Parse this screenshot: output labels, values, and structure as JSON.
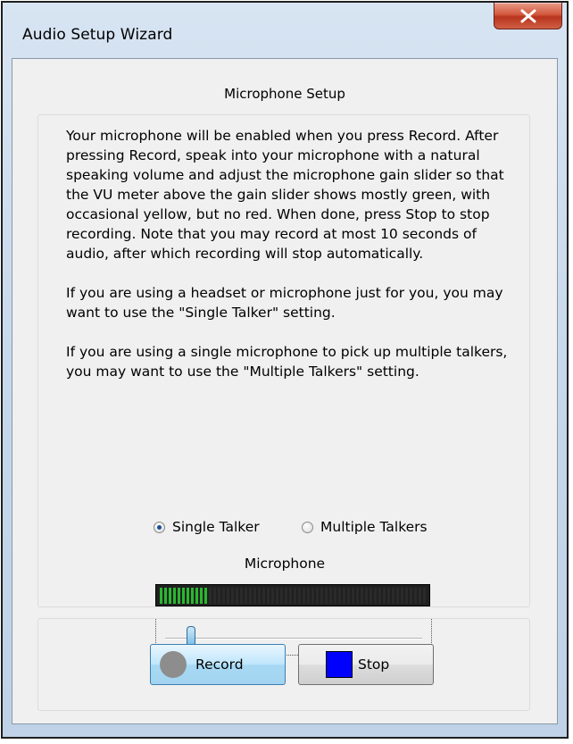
{
  "window": {
    "title": "Audio Setup Wizard"
  },
  "section": {
    "title": "Microphone Setup"
  },
  "instructions": {
    "p1": "Your microphone will be enabled when you press Record. After pressing Record, speak into your microphone with a natural speaking volume and adjust the microphone gain slider so that the VU meter above the gain slider shows mostly green, with occasional yellow, but no red.  When done, press Stop to stop recording.  Note that you may record at most 10 seconds of audio, after which recording will stop automatically.",
    "p2": "If you are using a headset or microphone just for you, you may want to use the \"Single Talker\" setting.",
    "p3": "If you are using a single microphone to pick up multiple talkers, you may want to use the \"Multiple Talkers\" setting."
  },
  "talker_mode": {
    "single_label": "Single Talker",
    "multiple_label": "Multiple Talkers",
    "selected": "single"
  },
  "microphone": {
    "label": "Microphone",
    "vu_level": 0.18,
    "gain_level": 0.1
  },
  "buttons": {
    "record_label": "Record",
    "stop_label": "Stop"
  },
  "colors": {
    "vu_active": "#29b82f",
    "stop_square": "#0000ff",
    "record_circle": "#8d8d8d",
    "close_button": "#c7452a"
  },
  "icons": {
    "close": "close-x-icon",
    "record": "record-circle-icon",
    "stop": "stop-square-icon"
  }
}
